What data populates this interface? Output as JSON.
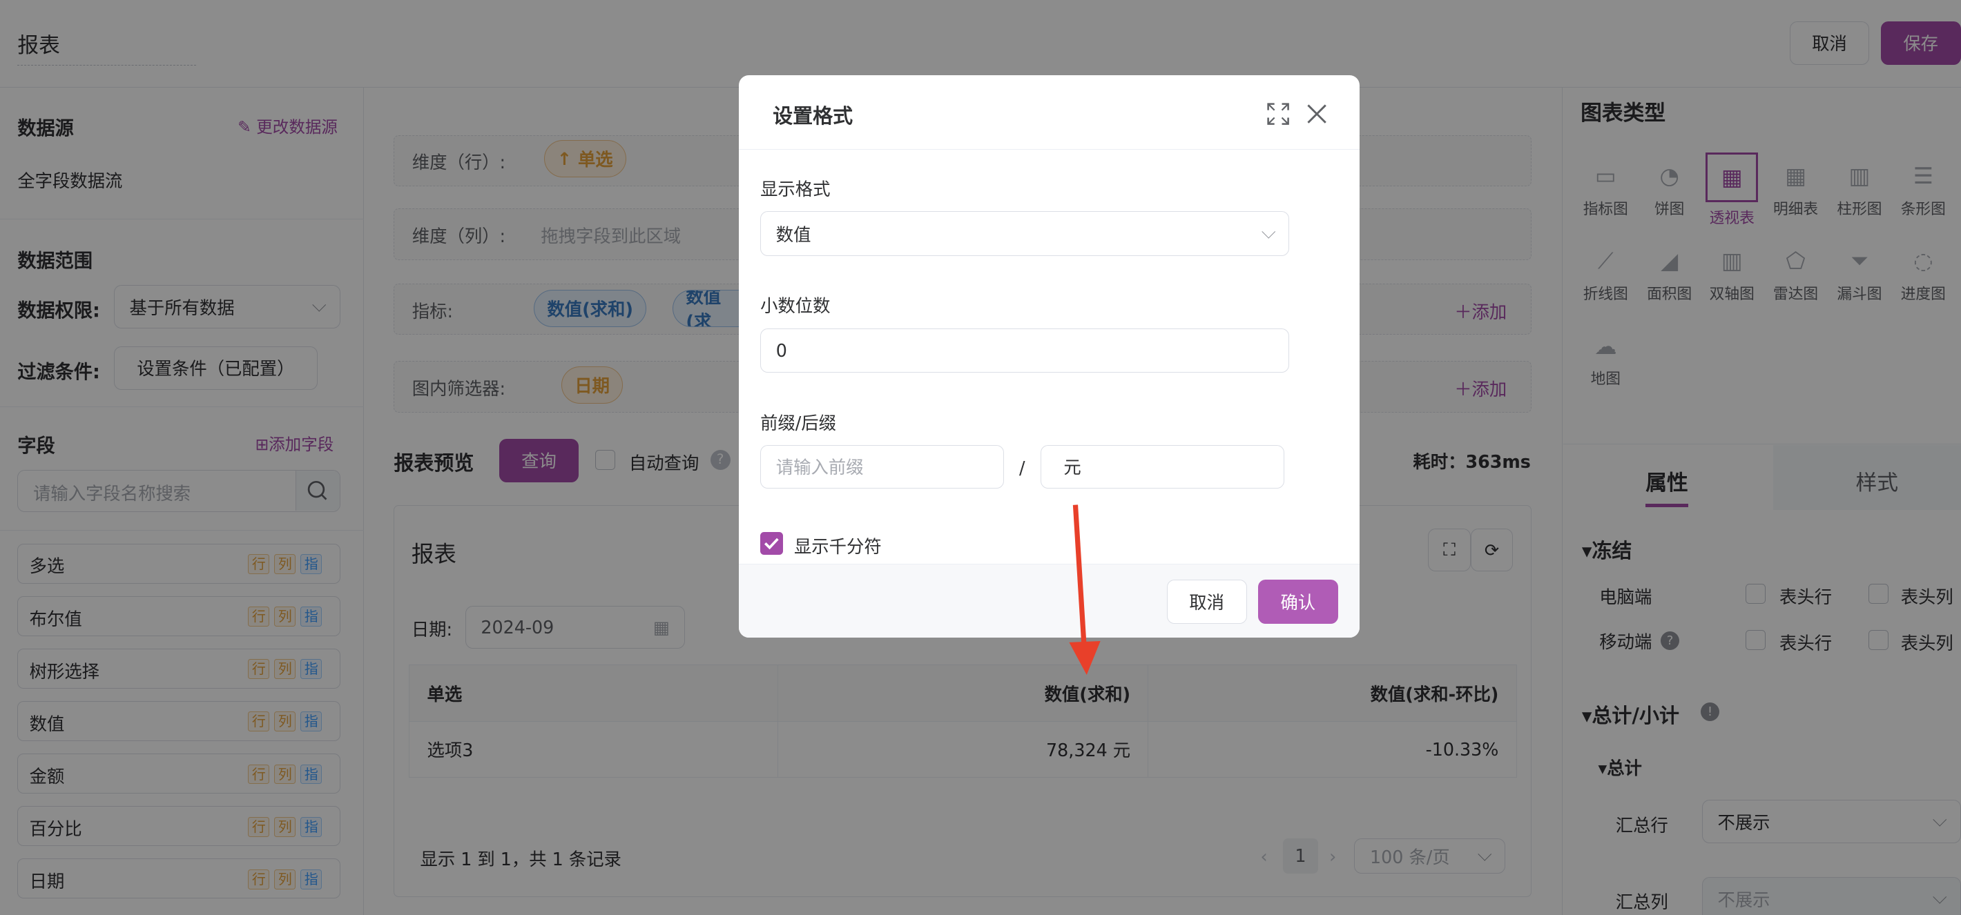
{
  "header": {
    "title": "报表",
    "cancel": "取消",
    "save": "保存"
  },
  "left": {
    "datasource_title": "数据源",
    "change_source": "更改数据源",
    "source_name": "全字段数据流",
    "range_title": "数据范围",
    "permission_label": "数据权限:",
    "permission_value": "基于所有数据",
    "filter_label": "过滤条件:",
    "filter_value": "设置条件（已配置）",
    "fields_title": "字段",
    "add_field": "添加字段",
    "search_placeholder": "请输入字段名称搜索",
    "tag_row": "行",
    "tag_col": "列",
    "tag_metric": "指",
    "fields": [
      "多选",
      "布尔值",
      "树形选择",
      "数值",
      "金额",
      "百分比",
      "日期"
    ]
  },
  "main": {
    "dim_row_label": "维度（行）:",
    "dim_row_chip": "单选",
    "dim_col_label": "维度（列）:",
    "dim_col_placeholder": "拖拽字段到此区域",
    "metric_label": "指标:",
    "metric_chip1": "数值(求和)",
    "metric_chip2": "数值(求",
    "add": "添加",
    "filter_label": "图内筛选器:",
    "filter_chip": "日期",
    "preview_title": "报表预览",
    "query": "查询",
    "auto_query": "自动查询",
    "elapsed": "耗时：363ms",
    "report_title": "报表",
    "date_label": "日期:",
    "date_value": "2024-09",
    "table": {
      "headers": [
        "单选",
        "数值(求和)",
        "数值(求和-环比)"
      ],
      "row": [
        "选项3",
        "78,324 元",
        "-10.33%"
      ]
    },
    "footer_text": "显示 1 到 1，共 1 条记录",
    "page": "1",
    "page_size": "100 条/页"
  },
  "right": {
    "chart_type_title": "图表类型",
    "chart_types": [
      "指标图",
      "饼图",
      "透视表",
      "明细表",
      "柱形图",
      "条形图",
      "折线图",
      "面积图",
      "双轴图",
      "雷达图",
      "漏斗图",
      "进度图",
      "地图"
    ],
    "tab_props": "属性",
    "tab_style": "样式",
    "freeze_title": "冻结",
    "desktop": "电脑端",
    "mobile": "移动端",
    "header_row": "表头行",
    "header_col": "表头列",
    "total_title": "总计/小计",
    "total_sub": "总计",
    "sum_row": "汇总行",
    "sum_row_value": "不展示",
    "sum_col": "汇总列",
    "sum_col_value": "不展示"
  },
  "dialog": {
    "title": "设置格式",
    "display_format_label": "显示格式",
    "display_format_value": "数值",
    "decimal_label": "小数位数",
    "decimal_value": "0",
    "prefix_suffix_label": "前缀/后缀",
    "prefix_placeholder": "请输入前缀",
    "separator": "/",
    "suffix_value": "元",
    "thousands_label": "显示千分符",
    "cancel": "取消",
    "confirm": "确认"
  },
  "colors": {
    "accent": "#a24ba8",
    "annotation_arrow": "#e8402a"
  }
}
